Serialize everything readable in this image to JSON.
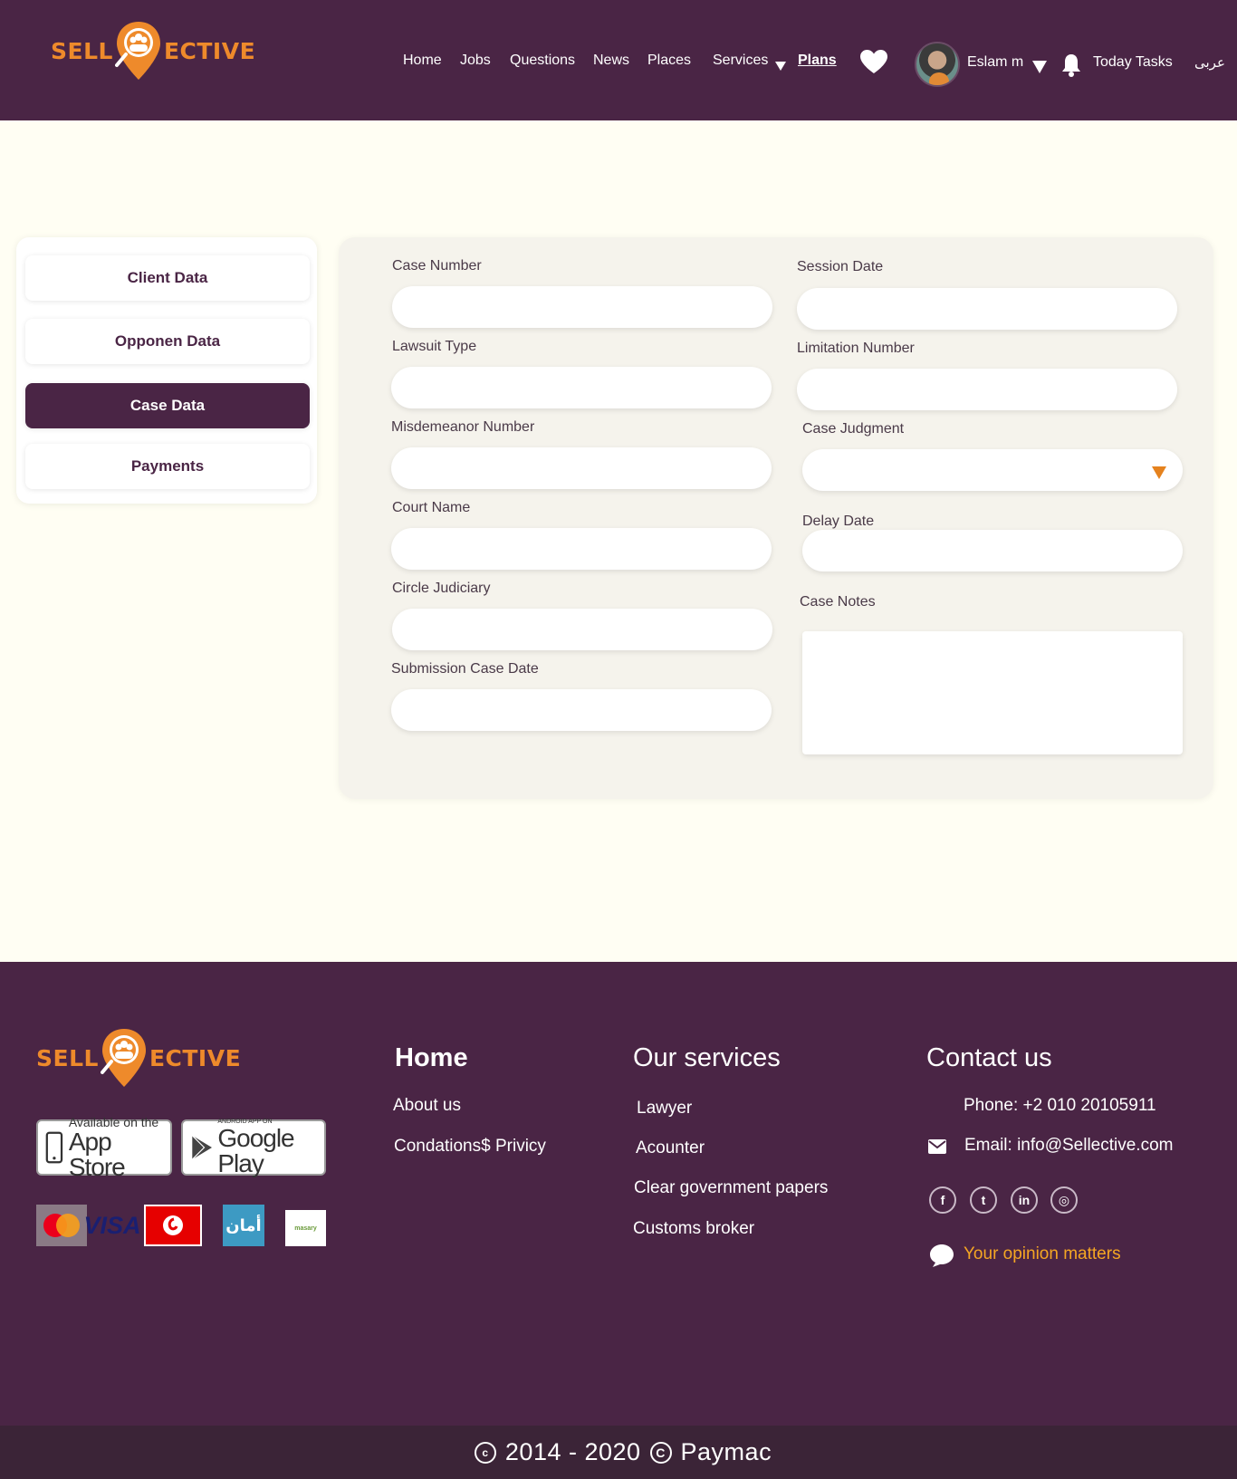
{
  "brand": {
    "left": "SELL",
    "right": "ECTIVE",
    "accent": "#ee8a2b",
    "primary": "#4a2545"
  },
  "nav": {
    "home": "Home",
    "jobs": "Jobs",
    "questions": "Questions",
    "news": "News",
    "places": "Places",
    "services": "Services",
    "plans": "Plans",
    "user_name": "Eslam m",
    "today_tasks": "Today Tasks",
    "language": "عربى"
  },
  "sidebar": {
    "items": [
      {
        "label": "Client Data"
      },
      {
        "label": "Opponen Data"
      },
      {
        "label": "Case Data"
      },
      {
        "label": "Payments"
      }
    ],
    "active": "Case Data"
  },
  "form": {
    "case_number": "Case Number",
    "session_date": "Session Date",
    "lawsuit_type": "Lawsuit Type",
    "limitation_number": "Limitation Number",
    "misdemeanor_number": "Misdemeanor Number",
    "case_judgment": "Case Judgment",
    "court_name": "Court Name",
    "delay_date": "Delay Date",
    "circle_judiciary": "Circle Judiciary",
    "case_notes": "Case Notes",
    "submission_case_date": "Submission Case Date"
  },
  "footer": {
    "app_store": {
      "small": "Available on the",
      "big": "App Store"
    },
    "google_play": {
      "small": "ANDROID APP ON",
      "big": "Google Play"
    },
    "payments": {
      "visa": "VISA",
      "mastercard": "mastercard",
      "vodafone": "vodafone cash",
      "aman": "أمان",
      "masary": "masary"
    },
    "home_title": "Home",
    "about": "About us",
    "conditions": "Condations$ Privicy",
    "services_title": "Our services",
    "services": [
      "Lawyer",
      "Acounter",
      "Clear government papers",
      "Customs broker"
    ],
    "contact_title": "Contact us",
    "phone": "Phone: +2 010 20105911",
    "email": "Email: info@Sellective.com",
    "opinion": "Your opinion matters"
  },
  "copyright": {
    "years": "2014 - 2020",
    "owner": "Paymac"
  }
}
